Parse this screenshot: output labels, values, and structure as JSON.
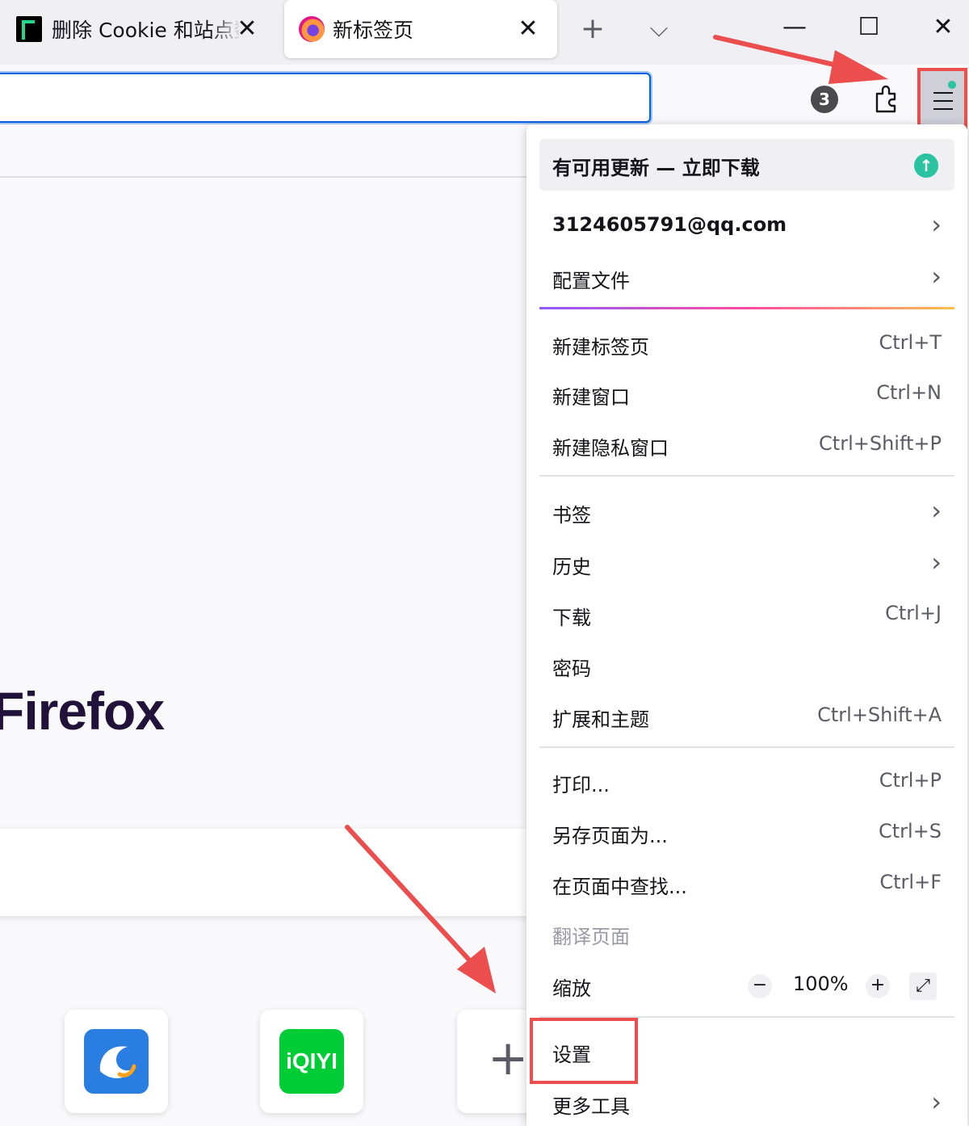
{
  "tabs": [
    {
      "title": "删除 Cookie 和站点数",
      "close": "✕"
    },
    {
      "title": "新标签页",
      "close": "✕"
    }
  ],
  "tabstrip": {
    "new_tab": "+",
    "list_all": "⌵"
  },
  "window_controls": {
    "minimize": "—",
    "maximize": "☐",
    "close": "✕"
  },
  "toolbar": {
    "badge_count": "3"
  },
  "page": {
    "brand_text": "Firefox",
    "tiles": [
      "ctrip",
      "iqiyi",
      "add"
    ],
    "iqiyi_text": "iQIYI",
    "add_label": "+"
  },
  "menu": {
    "update": {
      "label": "有可用更新 — 立即下载",
      "icon": "↑"
    },
    "account": {
      "label": "3124605791@qq.com",
      "chevron": "›"
    },
    "profiles": {
      "label": "配置文件",
      "chevron": "›"
    },
    "items": [
      {
        "label": "新建标签页",
        "shortcut": "Ctrl+T"
      },
      {
        "label": "新建窗口",
        "shortcut": "Ctrl+N"
      },
      {
        "label": "新建隐私窗口",
        "shortcut": "Ctrl+Shift+P"
      },
      {
        "label": "书签",
        "chevron": "›"
      },
      {
        "label": "历史",
        "chevron": "›"
      },
      {
        "label": "下载",
        "shortcut": "Ctrl+J"
      },
      {
        "label": "密码"
      },
      {
        "label": "扩展和主题",
        "shortcut": "Ctrl+Shift+A"
      },
      {
        "label": "打印...",
        "shortcut": "Ctrl+P"
      },
      {
        "label": "另存页面为...",
        "shortcut": "Ctrl+S"
      },
      {
        "label": "在页面中查找...",
        "shortcut": "Ctrl+F"
      },
      {
        "label": "翻译页面"
      },
      {
        "label": "缩放"
      },
      {
        "label": "设置"
      },
      {
        "label": "更多工具",
        "chevron": "›"
      }
    ],
    "zoom": {
      "minus": "−",
      "value": "100%",
      "plus": "+",
      "fullscreen": "⤢"
    }
  },
  "colors": {
    "highlight": "#ec4d4d",
    "accent": "#0061e0",
    "update_green": "#2ac3a2"
  }
}
